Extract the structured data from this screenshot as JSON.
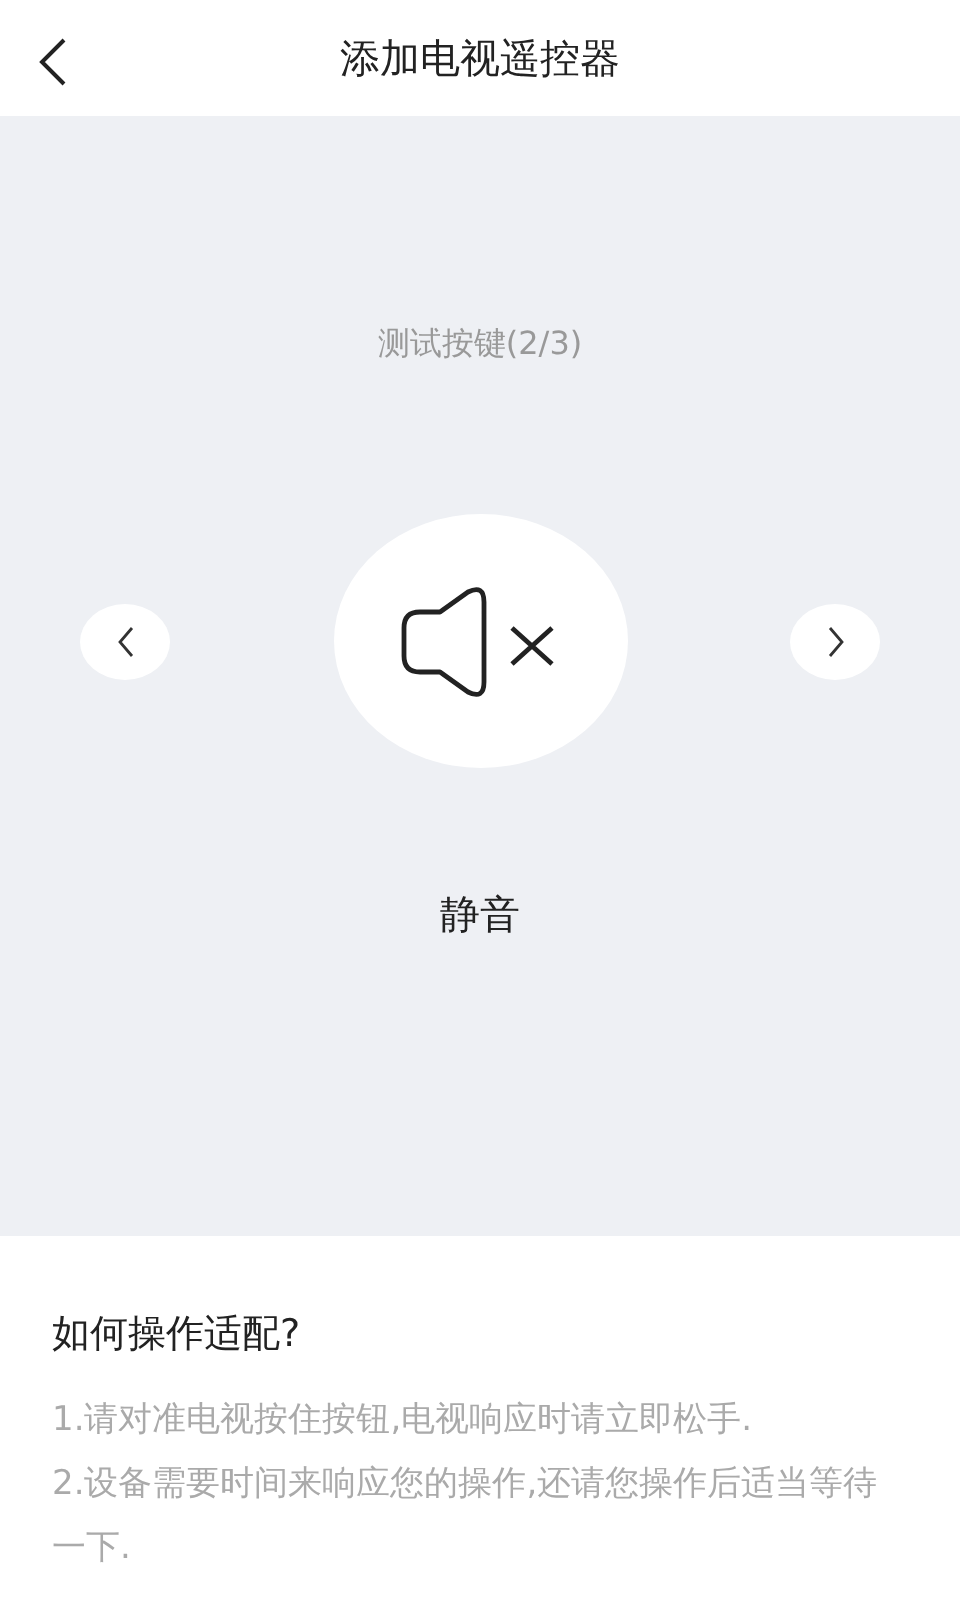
{
  "header": {
    "title": "添加电视遥控器"
  },
  "test": {
    "step": "测试按键(2/3)",
    "key_label": "静音"
  },
  "help": {
    "heading": "如何操作适配?",
    "steps": [
      "1.请对准电视按住按钮,电视响应时请立即松手.",
      "2.设备需要时间来响应您的操作,还请您操作后适当等待一下."
    ]
  }
}
